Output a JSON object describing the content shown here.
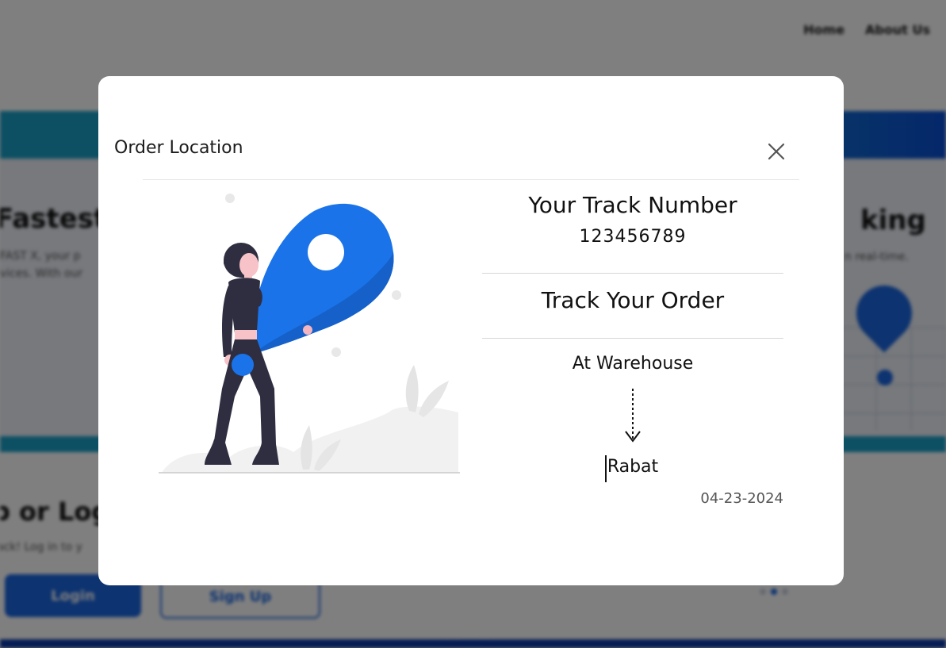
{
  "background": {
    "nav": {
      "home": "Home",
      "about": "About Us"
    },
    "hero_left": {
      "title": "Fastest d",
      "sub_1": "FAST X, your p",
      "sub_2": "vices. With our"
    },
    "hero_right": {
      "title": "king",
      "sub": "n real-time."
    },
    "card_left": {
      "title": "p or Logi",
      "sub": "ack! Log in to y"
    },
    "buttons": {
      "login": "Login",
      "signup": "Sign Up"
    }
  },
  "modal": {
    "title": "Order Location",
    "close_icon": "close-icon",
    "illustration": "woman-with-location-pin-illustration",
    "track_number_label": "Your Track Number",
    "track_number_value": "123456789",
    "track_order_label": "Track Your Order",
    "status_from": "At Warehouse",
    "status_to": "Rabat",
    "status_date": "04-23-2024"
  },
  "colors": {
    "accent": "#1a73e8",
    "overlay": "rgba(0,0,0,0.5)",
    "text": "#111111",
    "muted": "#555555"
  }
}
